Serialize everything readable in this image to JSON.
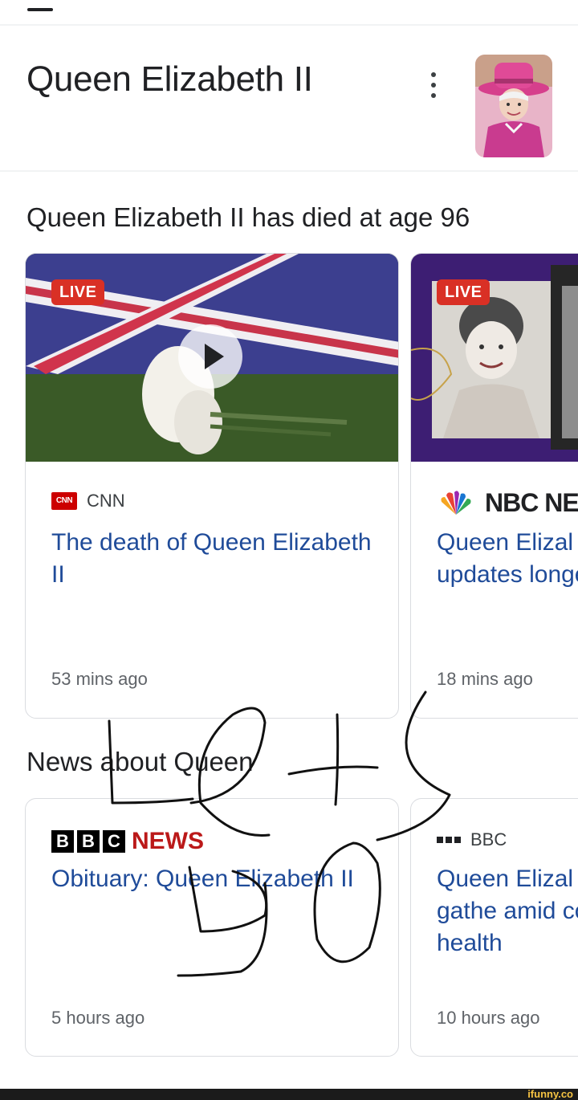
{
  "header": {
    "title": "Queen Elizabeth II",
    "more_icon": "more-vert-icon",
    "avatar_alt": "Queen Elizabeth II photo"
  },
  "top_stories": {
    "title": "Queen Elizabeth II has died at age 96",
    "cards": [
      {
        "badge": "LIVE",
        "source": "CNN",
        "headline": "The death of Queen Elizabeth II",
        "time": "53 mins ago",
        "has_play": true
      },
      {
        "badge": "LIVE",
        "source": "NBC NE",
        "headline": "Queen Elizal live updates longest-serv",
        "time": "18 mins ago"
      }
    ]
  },
  "news": {
    "title": "News about Queen",
    "cards": [
      {
        "source_letters": [
          "B",
          "B",
          "C"
        ],
        "source": "NEWS",
        "headline": "Obituary: Queen Elizabeth II",
        "time": "5 hours ago"
      },
      {
        "source": "BBC",
        "headline": "Queen Elizal Family gathe amid concer health",
        "time": "10 hours ago"
      }
    ]
  },
  "watermark": "ifunny.co",
  "colors": {
    "live_badge": "#d93025",
    "headline_link": "#1f4b99",
    "bbc_news_red": "#bb1919"
  }
}
